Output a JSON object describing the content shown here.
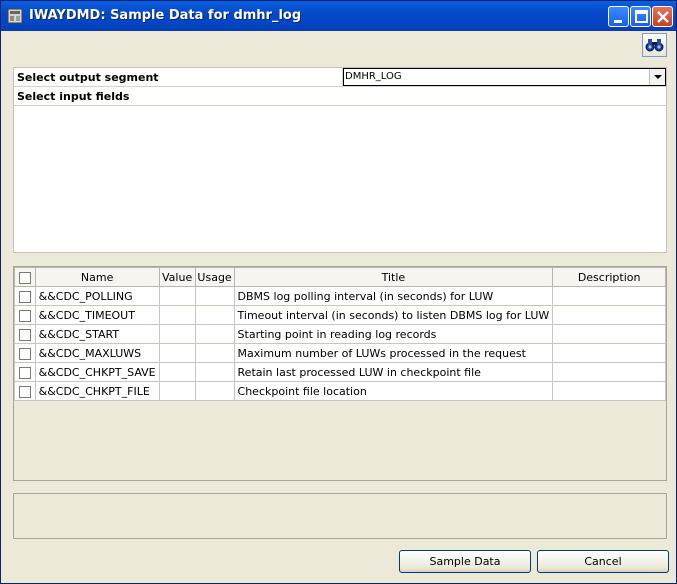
{
  "window": {
    "title": "IWAYDMD: Sample Data for dmhr_log",
    "title_color": "#0a5fe0",
    "window_bg": "#ece9d8"
  },
  "toolbar": {
    "find_icon": "binoculars-icon"
  },
  "segment": {
    "label": "Select output segment",
    "selected": "DMHR_LOG"
  },
  "fields": {
    "label": "Select input fields"
  },
  "grid": {
    "columns": [
      "",
      "Name",
      "Value",
      "Usage",
      "Title",
      "Description"
    ],
    "rows": [
      {
        "name": "&&CDC_POLLING",
        "value": "",
        "usage": "",
        "title": "DBMS log polling interval (in seconds) for LUW",
        "description": ""
      },
      {
        "name": "&&CDC_TIMEOUT",
        "value": "",
        "usage": "",
        "title": "Timeout interval (in seconds) to listen DBMS log for LUW",
        "description": ""
      },
      {
        "name": "&&CDC_START",
        "value": "",
        "usage": "",
        "title": "Starting point in reading log records",
        "description": ""
      },
      {
        "name": "&&CDC_MAXLUWS",
        "value": "",
        "usage": "",
        "title": "Maximum number of LUWs processed in the request",
        "description": ""
      },
      {
        "name": "&&CDC_CHKPT_SAVE",
        "value": "",
        "usage": "",
        "title": "Retain last processed LUW in checkpoint file",
        "description": ""
      },
      {
        "name": "&&CDC_CHKPT_FILE",
        "value": "",
        "usage": "",
        "title": "Checkpoint file location",
        "description": ""
      }
    ]
  },
  "buttons": {
    "sample_data": "Sample Data",
    "cancel": "Cancel"
  }
}
